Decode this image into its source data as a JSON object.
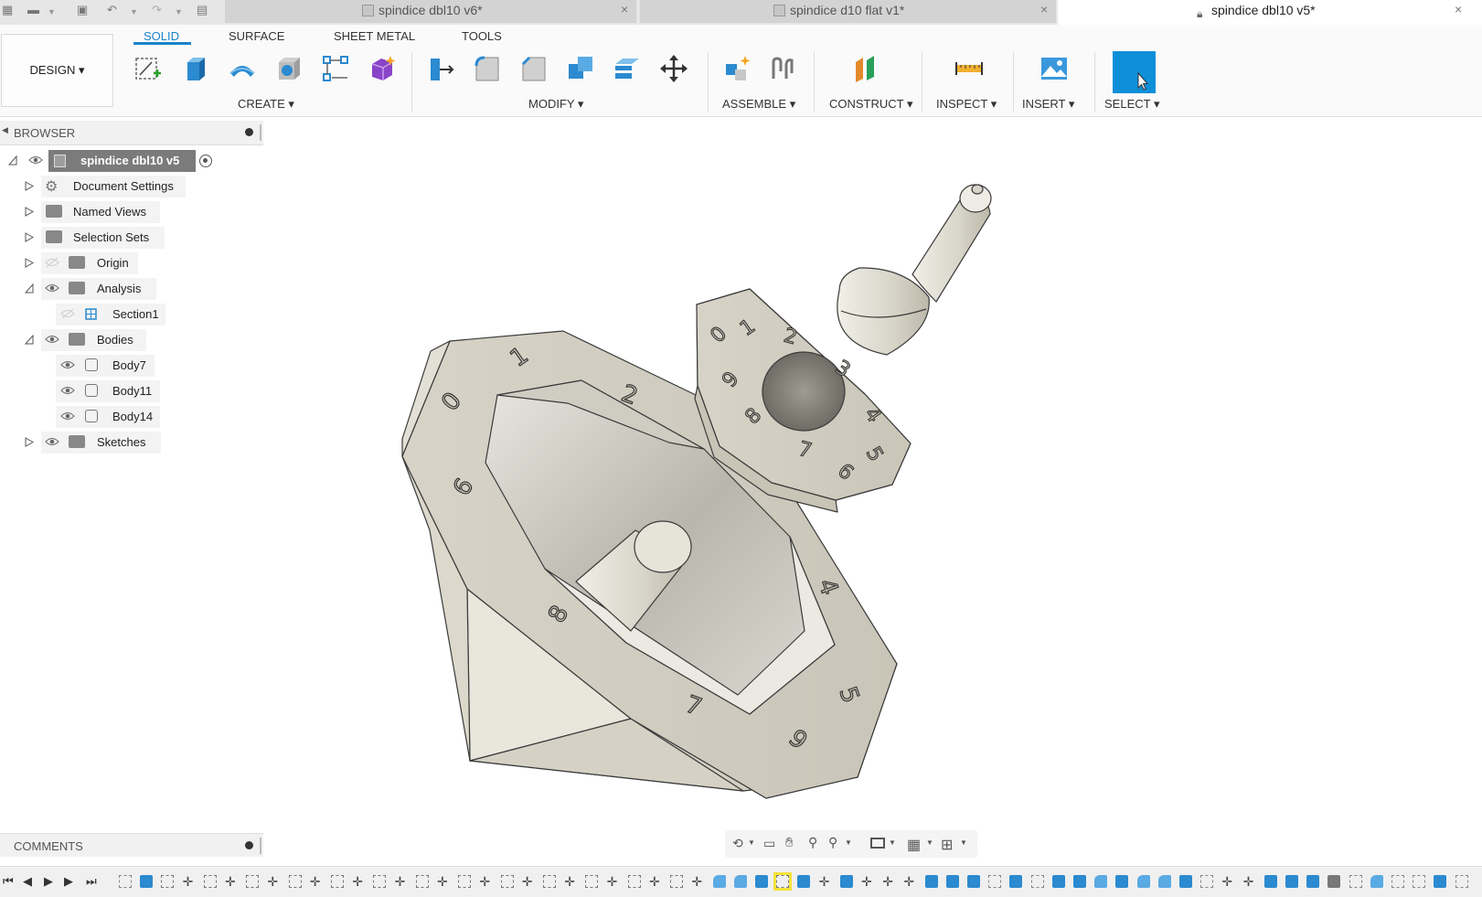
{
  "tabs": [
    {
      "label": "spindice dbl10 v6*",
      "active": false
    },
    {
      "label": "spindice d10 flat v1*",
      "active": false
    },
    {
      "label": "spindice dbl10 v5*",
      "active": true
    }
  ],
  "ribbon": {
    "design_label": "DESIGN ▾",
    "workspace_tabs": [
      "SOLID",
      "SURFACE",
      "SHEET METAL",
      "TOOLS"
    ],
    "groups": {
      "create": "CREATE ▾",
      "modify": "MODIFY ▾",
      "assemble": "ASSEMBLE ▾",
      "construct": "CONSTRUCT ▾",
      "inspect": "INSPECT ▾",
      "insert": "INSERT ▾",
      "select": "SELECT ▾"
    }
  },
  "browser": {
    "title": "BROWSER",
    "root": "spindice dbl10 v5",
    "items": [
      {
        "label": "Document Settings"
      },
      {
        "label": "Named Views"
      },
      {
        "label": "Selection Sets"
      },
      {
        "label": "Origin"
      },
      {
        "label": "Analysis"
      },
      {
        "label": "Section1"
      },
      {
        "label": "Bodies"
      },
      {
        "label": "Body7"
      },
      {
        "label": "Body11"
      },
      {
        "label": "Body14"
      },
      {
        "label": "Sketches"
      }
    ]
  },
  "comments": {
    "title": "COMMENTS"
  },
  "colors": {
    "accent": "#1a83c8",
    "select_highlight": "#0e8fd8",
    "model_fill": "#d9d6c9",
    "model_edge": "#3a3a3a"
  }
}
